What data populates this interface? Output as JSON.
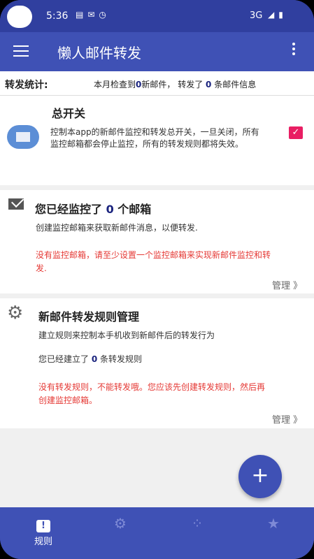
{
  "status_bar": {
    "time": "5:36",
    "network": "3G",
    "left_icons": [
      "message-icon",
      "email-icon",
      "clock-icon"
    ],
    "right_icons": [
      "wifi-icon",
      "signal-icon",
      "battery-icon"
    ]
  },
  "app_bar": {
    "title": "懒人邮件转发"
  },
  "stats": {
    "label": "转发统计:",
    "text_prefix": "本月检查到",
    "new_mail_count": "0",
    "text_middle": "新邮件，  转发了 ",
    "forward_count": "0",
    "text_suffix": " 条邮件信息"
  },
  "master_switch": {
    "title": "总开关",
    "description": "控制本app的新邮件监控和转发总开关，一旦关闭，所有监控邮箱都会停止监控，所有的转发规则都将失效。",
    "checked": true
  },
  "mailbox_card": {
    "title_prefix": "您已经监控了 ",
    "count": "0",
    "title_suffix": " 个邮箱",
    "description": "创建监控邮箱来获取新邮件消息，以便转发.",
    "warning": "没有监控邮箱，请至少设置一个监控邮箱来实现新邮件监控和转发.",
    "manage_label": "管理 》"
  },
  "rules_card": {
    "title": "新邮件转发规则管理",
    "description": "建立规则来控制本手机收到新邮件后的转发行为",
    "count_prefix": "您已经建立了 ",
    "count": "0",
    "count_suffix": " 条转发规则",
    "warning": "没有转发规则，不能转发哦。您应该先创建转发规则，然后再创建监控邮箱。",
    "manage_label": "管理 》"
  },
  "fab": {
    "label": "+"
  },
  "bottom_nav": {
    "items": [
      {
        "label": "规则",
        "icon": "rule-icon",
        "active": true
      },
      {
        "label": "",
        "icon": "settings-icon",
        "active": false
      },
      {
        "label": "",
        "icon": "dots-icon",
        "active": false
      },
      {
        "label": "",
        "icon": "star-icon",
        "active": false
      }
    ]
  },
  "colors": {
    "primary": "#3f51b5",
    "primary_dark": "#303f9f",
    "accent": "#e91e63",
    "warning": "#e53935"
  }
}
